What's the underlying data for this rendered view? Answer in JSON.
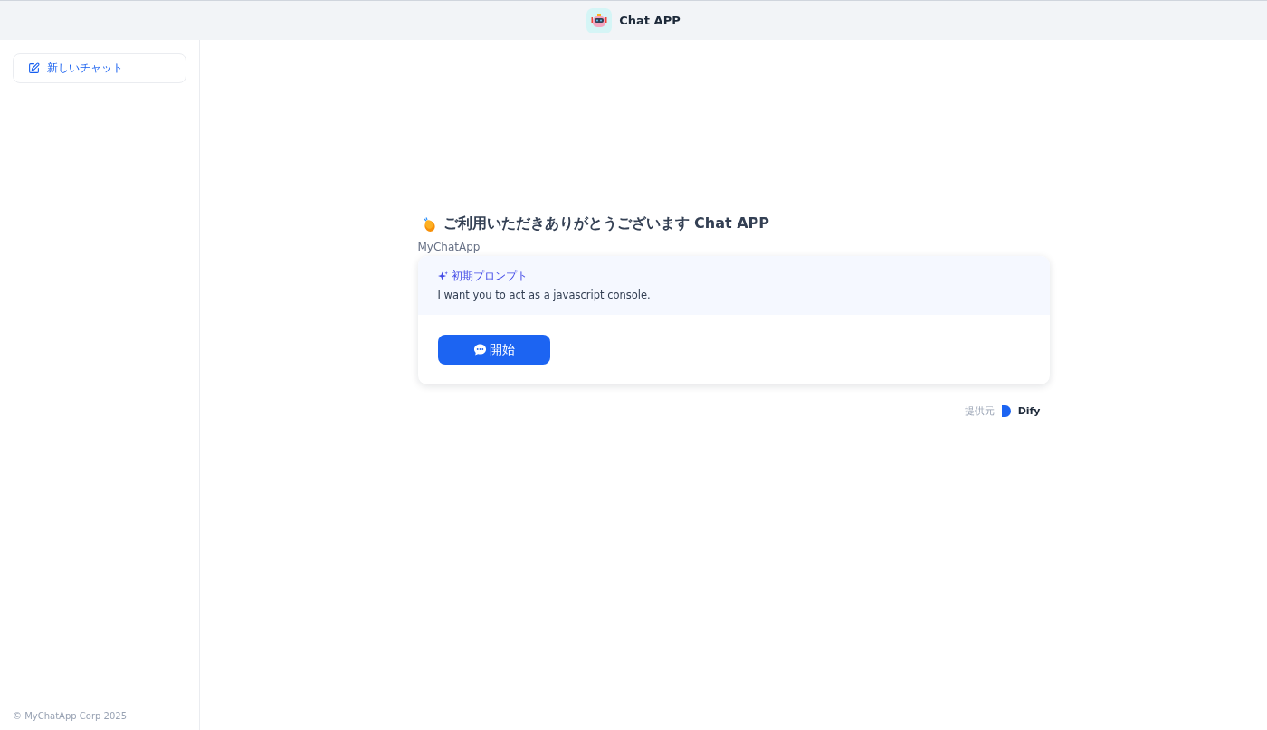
{
  "header": {
    "title": "Chat APP"
  },
  "sidebar": {
    "new_chat_button": "新しいチャット",
    "footer": "© MyChatApp Corp 2025"
  },
  "welcome": {
    "title": "ご利用いただきありがとうございます Chat APP",
    "subtitle": "MyChatApp",
    "prompt": {
      "label": "初期プロンプト",
      "text": "I want you to act as a javascript console."
    },
    "start_button": "開始"
  },
  "powered_by": {
    "label": "提供元",
    "brand": "Dify"
  }
}
